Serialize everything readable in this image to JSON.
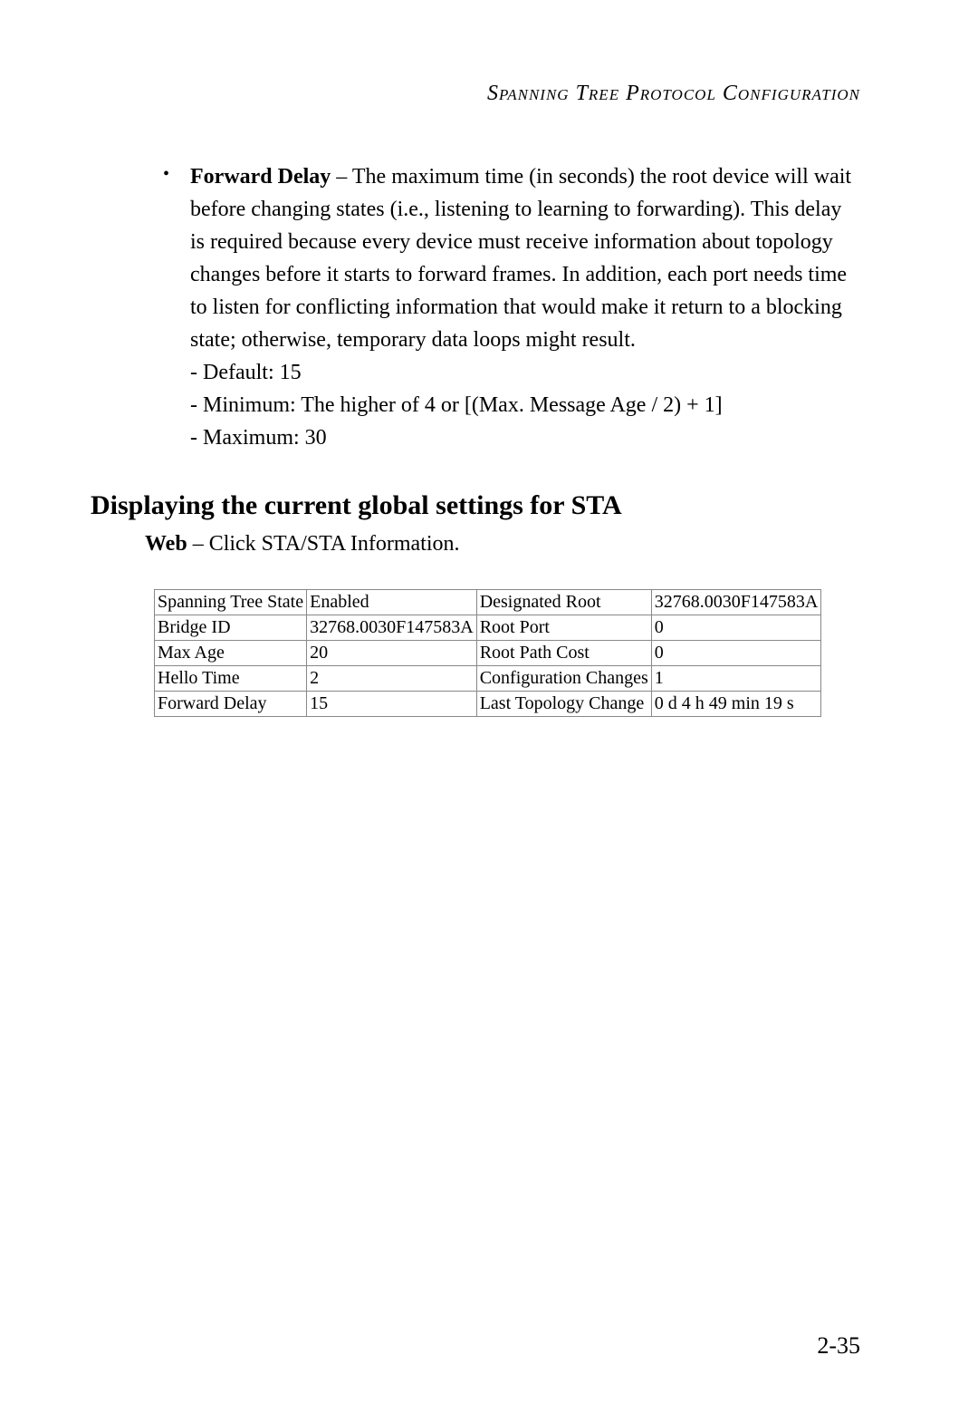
{
  "header": {
    "title": "Spanning Tree Protocol Configuration"
  },
  "bullet": {
    "label": "Forward Delay",
    "separator": " – ",
    "description": "The maximum time (in seconds) the root device will wait before changing states (i.e., listening to learning to forwarding). This delay is required because every device must receive information about topology changes before it starts to forward frames. In addition, each port needs time to listen for conflicting information that would make it return to a blocking state; otherwise, temporary data loops might result.",
    "sub_items": [
      "- Default: 15",
      "- Minimum: The higher of 4 or [(Max. Message Age / 2) + 1]",
      "- Maximum: 30"
    ]
  },
  "section": {
    "heading": "Displaying the current global settings for STA",
    "instruction_label": "Web",
    "instruction_sep": " – ",
    "instruction_text": "Click STA/STA Information."
  },
  "table": {
    "rows": [
      {
        "c1": "Spanning Tree State",
        "c2": "Enabled",
        "c3": "Designated Root",
        "c4": "32768.0030F147583A"
      },
      {
        "c1": "Bridge ID",
        "c2": "32768.0030F147583A",
        "c3": "Root Port",
        "c4": "0"
      },
      {
        "c1": "Max Age",
        "c2": "20",
        "c3": "Root Path Cost",
        "c4": "0"
      },
      {
        "c1": "Hello Time",
        "c2": "2",
        "c3": "Configuration Changes",
        "c4": "1"
      },
      {
        "c1": "Forward Delay",
        "c2": "15",
        "c3": "Last Topology Change",
        "c4": "0 d 4 h 49 min 19 s"
      }
    ]
  },
  "page_number": "2-35"
}
